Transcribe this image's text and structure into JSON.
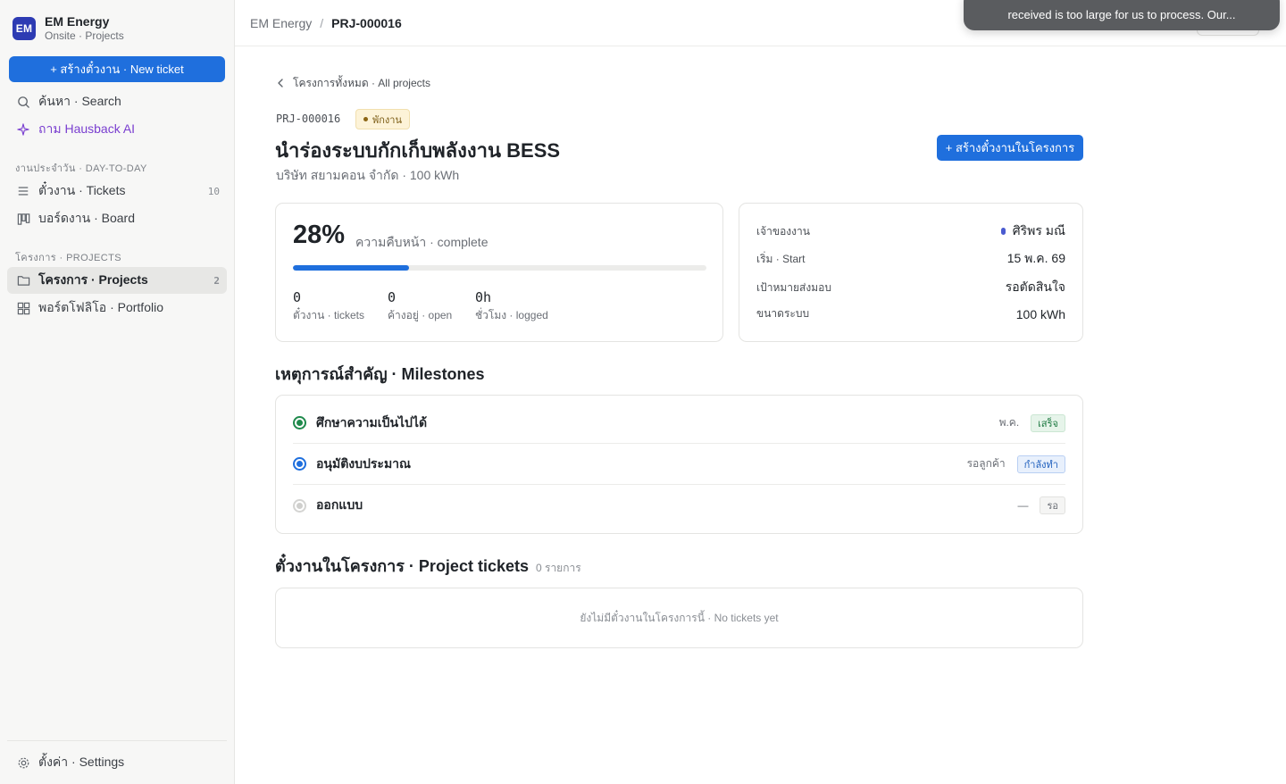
{
  "sidebar": {
    "org_initials": "EM",
    "org_name": "EM Energy",
    "org_sub": "Onsite · Projects",
    "new_ticket_label": "+ สร้างตั๋วงาน · New ticket",
    "search_label": "ค้นหา · Search",
    "ai_label": "ถาม Hausback AI",
    "section_day": "งานประจำวัน · DAY-TO-DAY",
    "tickets_label": "ตั๋วงาน · Tickets",
    "tickets_count": "10",
    "board_label": "บอร์ดงาน · Board",
    "section_projects": "โครงการ · PROJECTS",
    "projects_label": "โครงการ · Projects",
    "projects_count": "2",
    "portfolio_label": "พอร์ตโฟลิโอ · Portfolio",
    "settings_label": "ตั้งค่า · Settings"
  },
  "topbar": {
    "org": "EM Energy",
    "separator": "/",
    "current": "PRJ-000016",
    "toast_text": "received is too large for us to process. Our..."
  },
  "project": {
    "back_label": "โครงการทั้งหมด · All projects",
    "code": "PRJ-000016",
    "status": "พักงาน",
    "title": "นำร่องระบบกักเก็บพลังงาน BESS",
    "subtitle": "บริษัท สยามคอน จำกัด · 100 kWh",
    "create_button": "+ สร้างตั๋วงานในโครงการ"
  },
  "progress": {
    "percent_text": "28%",
    "percent_value": 28,
    "label": "ความคืบหน้า · complete",
    "stats": [
      {
        "value": "0",
        "label": "ตั๋วงาน · tickets"
      },
      {
        "value": "0",
        "label": "ค้างอยู่ · open"
      },
      {
        "value": "0h",
        "label": "ชั่วโมง · logged"
      }
    ]
  },
  "info": {
    "owner_key": "เจ้าของงาน",
    "owner_val": "ศิริพร มณี",
    "start_key": "เริ่ม · Start",
    "start_val": "15 พ.ค. 69",
    "target_key": "เป้าหมายส่งมอบ",
    "target_val": "รอตัดสินใจ",
    "size_key": "ขนาดระบบ",
    "size_val": "100 kWh"
  },
  "milestones": {
    "title": "เหตุการณ์สำคัญ · Milestones",
    "items": [
      {
        "name": "ศึกษาความเป็นไปได้",
        "date": "พ.ค.",
        "badge": "เสร็จ",
        "state": "done"
      },
      {
        "name": "อนุมัติงบประมาณ",
        "date": "รอลูกค้า",
        "badge": "กำลังทำ",
        "state": "active"
      },
      {
        "name": "ออกแบบ",
        "date": "—",
        "badge": "รอ",
        "state": "pending"
      }
    ]
  },
  "tickets": {
    "title": "ตั๋วงานในโครงการ · Project tickets",
    "count": "0 รายการ",
    "empty": "ยังไม่มีตั๋วงานในโครงการนี้ · No tickets yet"
  },
  "colors": {
    "accent": "#1f6fdd",
    "done": "#1f8a4c",
    "active": "#1f6fdd",
    "pending": "#c9c9c9"
  }
}
